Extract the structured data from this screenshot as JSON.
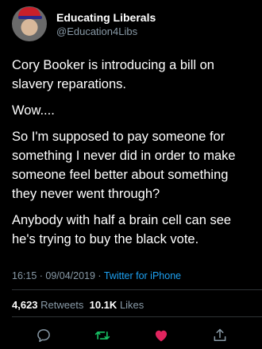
{
  "user": {
    "display_name": "Educating Liberals",
    "handle": "@Education4Libs"
  },
  "tweet": {
    "paragraphs": [
      "Cory Booker is introducing a bill on slavery reparations.",
      "Wow....",
      "So I'm supposed to pay someone for something I never did in order to make someone feel better about something they never went through?",
      "Anybody with half a brain cell can see he's trying to buy the black vote."
    ],
    "time": "16:15",
    "separator1": " · ",
    "date": "09/04/2019",
    "separator2": " · ",
    "source": "Twitter for iPhone"
  },
  "stats": {
    "retweets_count": "4,623",
    "retweets_label": "Retweets",
    "likes_count": "10.1K",
    "likes_label": "Likes"
  },
  "actions": {
    "reply_icon": "reply-icon",
    "retweet_icon": "retweet-icon",
    "like_icon": "like-icon",
    "share_icon": "share-icon"
  },
  "colors": {
    "background": "#000000",
    "text": "#ffffff",
    "secondary": "#8899a6",
    "link": "#1da1f2",
    "retweet": "#17bf63",
    "like": "#e0245e"
  }
}
